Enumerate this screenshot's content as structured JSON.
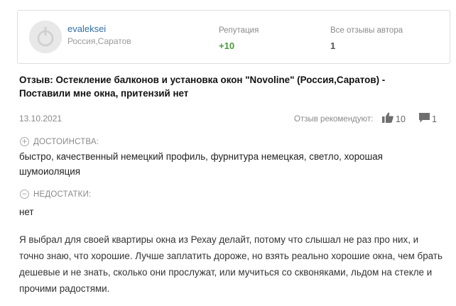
{
  "author": {
    "username": "evaleksei",
    "location": "Россия,Саратов",
    "reputation_label": "Репутация",
    "reputation_value": "+10",
    "all_reviews_label": "Все отзывы автора",
    "all_reviews_value": "1"
  },
  "review": {
    "title": "Отзыв: Остекление балконов и установка окон \"Novoline\" (Россия,Саратов) - Поставили мне окна, притензий нет",
    "date": "13.10.2021",
    "recommend_label": "Отзыв рекомендуют:",
    "likes": "10",
    "comments": "1",
    "pros_label": "ДОСТОИНСТВА:",
    "pros_text": "быстро, качественный немецкий профиль, фурнитура немецкая, светло, хорошая шумоиоляция",
    "cons_label": "НЕДОСТАТКИ:",
    "cons_text": "нет",
    "body": "Я выбрал для своей квартиры окна из Рехау делайт, потому что слышал не раз про них, и точно знаю, что хорошие. Лучше заплатить дороже, но взять реально хорошие окна, чем брать дешевые и не знать, сколько они прослужат, или мучиться со скво­няками, льдом на стекле и прочими радостями."
  },
  "colors": {
    "username": "#2f6ea6",
    "reputation": "#4a9a3a"
  },
  "icons": [
    "avatar-icon",
    "thumbs-up-icon",
    "comment-icon",
    "plus-circle-icon",
    "minus-circle-icon"
  ]
}
